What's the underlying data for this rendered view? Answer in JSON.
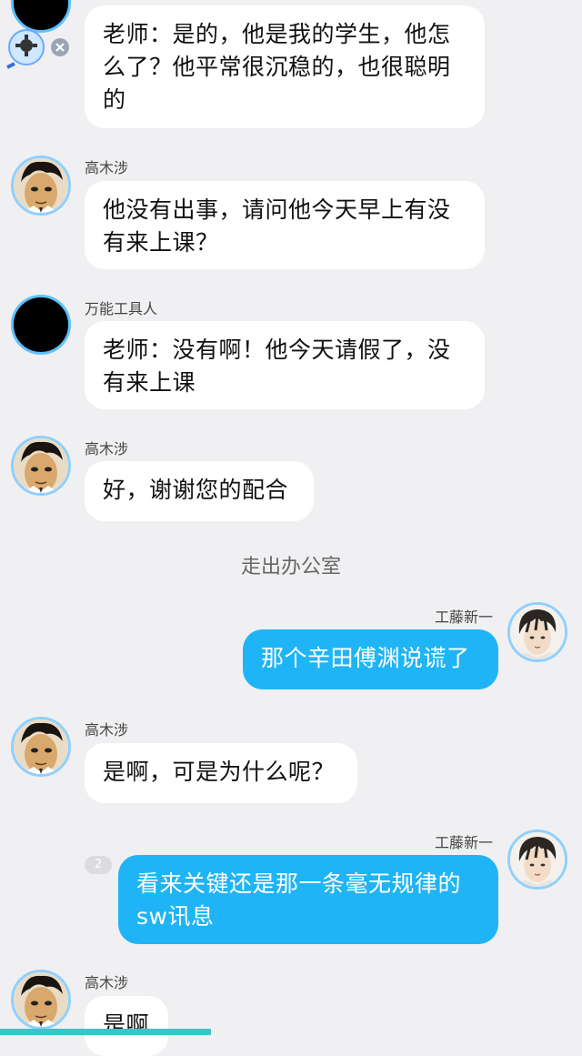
{
  "messages": [
    {
      "speaker": "",
      "lines": [
        "老师：是的，他是我的学生，他怎",
        "么了？他平常很沉稳的，也很聪明",
        "的"
      ]
    },
    {
      "speaker": "高木涉",
      "lines": [
        "他没有出事，请问他今天早上有没",
        "有来上课？"
      ]
    },
    {
      "speaker": "万能工具人",
      "lines": [
        "老师：没有啊！他今天请假了，没",
        "有来上课"
      ]
    },
    {
      "speaker": "高木涉",
      "lines": [
        "好，谢谢您的配合"
      ]
    },
    {
      "narration": "走出办公室"
    },
    {
      "speaker": "工藤新一",
      "lines": [
        "那个辛田傅渊说谎了"
      ]
    },
    {
      "speaker": "高木涉",
      "lines": [
        "是啊，可是为什么呢？"
      ]
    },
    {
      "speaker": "工藤新一",
      "badge": "2",
      "lines": [
        "看来关键还是那一条毫无规律的",
        "sw讯息"
      ]
    },
    {
      "speaker": "高木涉",
      "lines": [
        "是啊"
      ]
    }
  ],
  "icons": {
    "takagi_avatar": "takagi-avatar-icon",
    "kudo_avatar": "kudo-avatar-icon",
    "tool_avatar": "black-avatar-icon",
    "float_tool": "gear-magnifier-icon",
    "float_close": "close-icon"
  },
  "colors": {
    "background": "#f0f0f2",
    "bubble_left": "#ffffff",
    "bubble_right": "#1fb4f5",
    "scroll_indicator": "#3fc3c7"
  }
}
